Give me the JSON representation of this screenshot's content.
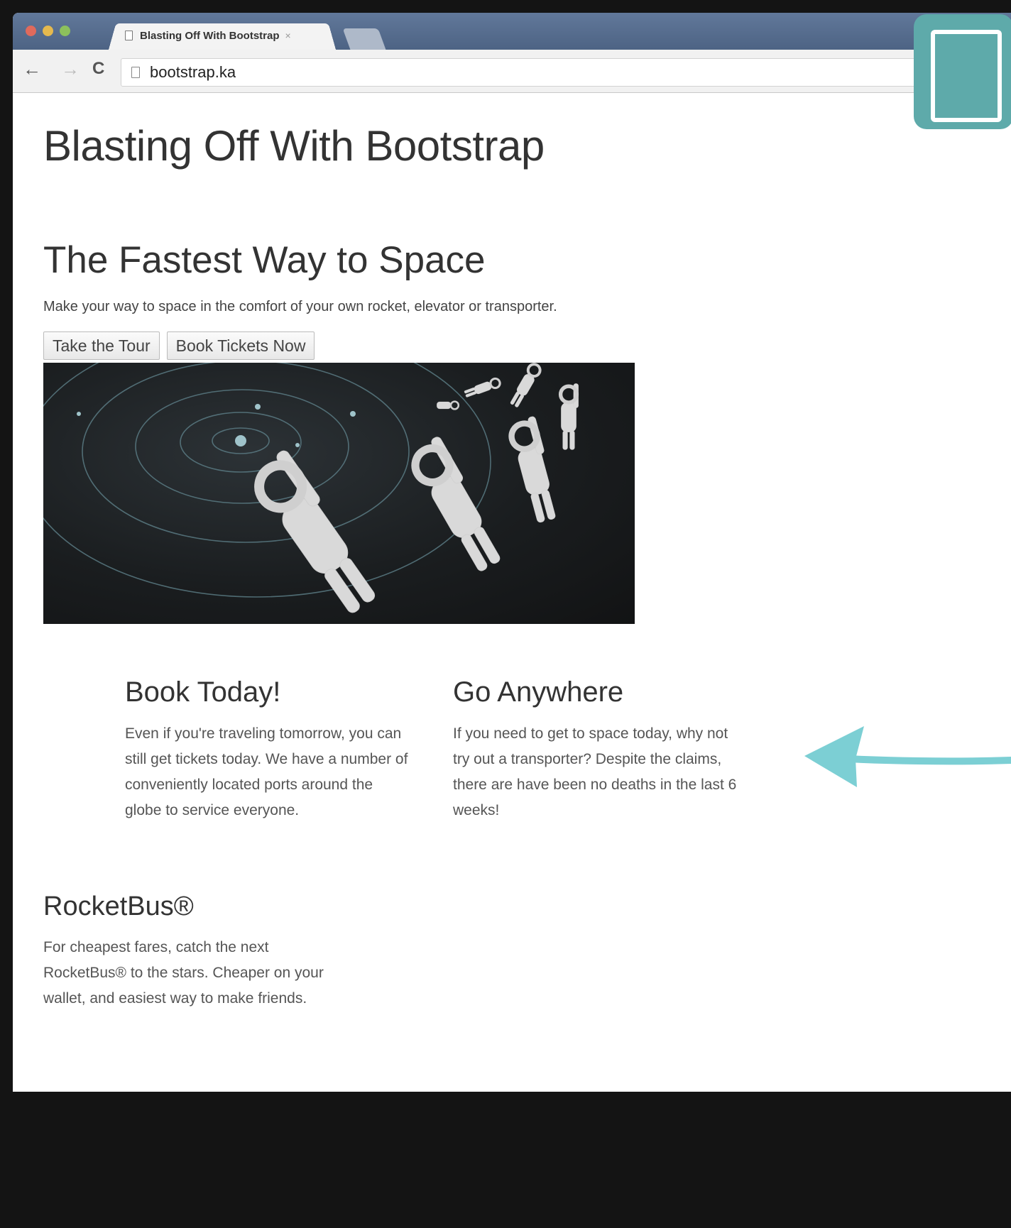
{
  "browser": {
    "tab_title": "Blasting Off With Bootstrap",
    "tab_close": "×",
    "url": "bootstrap.ka",
    "nav": {
      "back": "←",
      "forward": "→",
      "reload": "C"
    }
  },
  "page": {
    "site_title": "Blasting Off With Bootstrap",
    "hero": {
      "heading": "The Fastest Way to Space",
      "text": "Make your way to space in the comfort of your own rocket, elevator or transporter.",
      "buttons": [
        "Take the Tour",
        "Book Tickets Now"
      ]
    },
    "columns": [
      {
        "heading": "Book Today!",
        "text": "Even if you're traveling tomorrow, you can still get tickets today. We have a number of conveniently located ports around the globe to service everyone."
      },
      {
        "heading": "Go Anywhere",
        "text": "If you need to get to space today, why not try out a transporter? Despite the claims, there are have been no deaths in the last 6 weeks!"
      },
      {
        "heading": "RocketBus®",
        "text": "For cheapest fares, catch the next RocketBus® to the stars. Cheaper on your wallet, and easiest way to make friends."
      }
    ]
  },
  "overlay": {
    "icon": "tablet-icon",
    "accent": "#5eaaaa",
    "arrow_color": "#7ccfd4"
  }
}
